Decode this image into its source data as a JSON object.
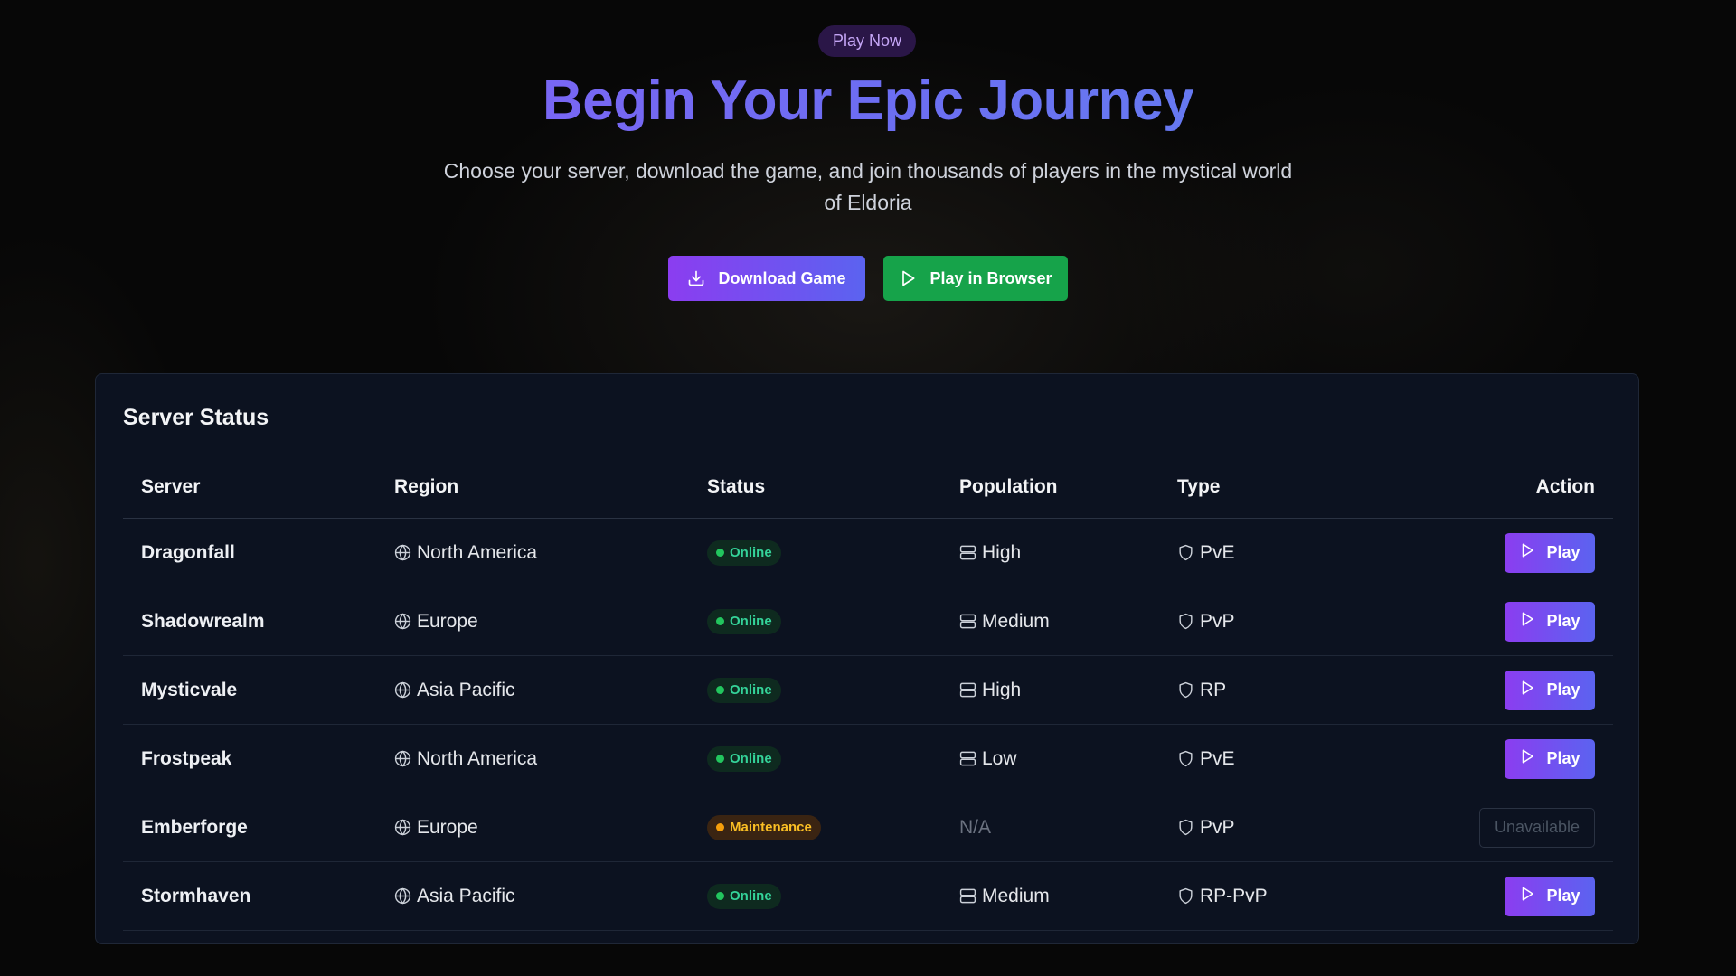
{
  "hero": {
    "badge": "Play Now",
    "title": "Begin Your Epic Journey",
    "subtitle": "Choose your server, download the game, and join thousands of players in the mystical world of Eldoria",
    "download_label": "Download Game",
    "browser_label": "Play in Browser"
  },
  "colors": {
    "accent_purple": "#8b3df0",
    "accent_blue": "#5b63f0",
    "online_green": "#22c55e",
    "maintenance_amber": "#f59e0b",
    "browser_green": "#16a34a"
  },
  "icons": {
    "download": "download-icon",
    "play": "play-icon",
    "region": "globe-icon",
    "population": "server-icon",
    "type": "shield-icon"
  },
  "server_status": {
    "title": "Server Status",
    "columns": [
      "Server",
      "Region",
      "Status",
      "Population",
      "Type",
      "Action"
    ],
    "rows": [
      {
        "server": "Dragonfall",
        "region": "North America",
        "status": "Online",
        "population": "High",
        "type": "PvE",
        "action": "Play"
      },
      {
        "server": "Shadowrealm",
        "region": "Europe",
        "status": "Online",
        "population": "Medium",
        "type": "PvP",
        "action": "Play"
      },
      {
        "server": "Mysticvale",
        "region": "Asia Pacific",
        "status": "Online",
        "population": "High",
        "type": "RP",
        "action": "Play"
      },
      {
        "server": "Frostpeak",
        "region": "North America",
        "status": "Online",
        "population": "Low",
        "type": "PvE",
        "action": "Play"
      },
      {
        "server": "Emberforge",
        "region": "Europe",
        "status": "Maintenance",
        "population": "N/A",
        "type": "PvP",
        "action": "Unavailable"
      },
      {
        "server": "Stormhaven",
        "region": "Asia Pacific",
        "status": "Online",
        "population": "Medium",
        "type": "RP-PvP",
        "action": "Play"
      }
    ]
  }
}
